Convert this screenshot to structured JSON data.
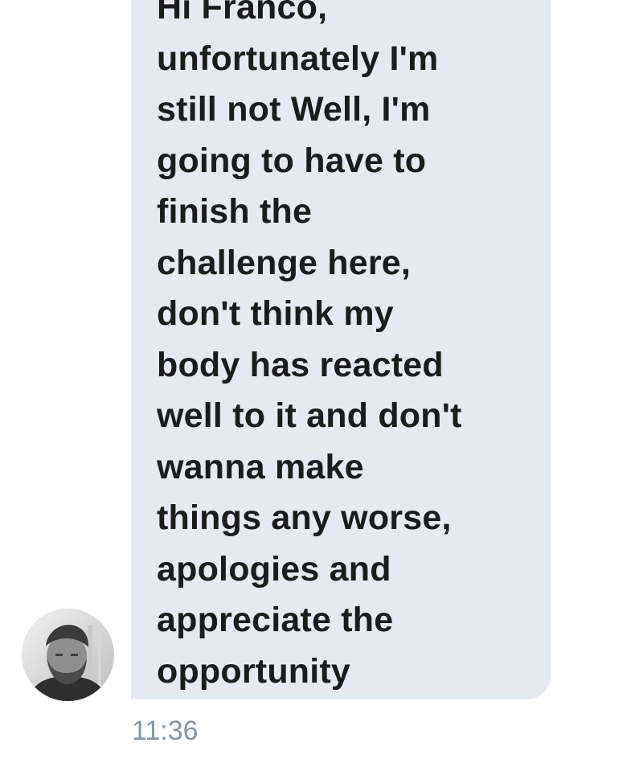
{
  "conversation": {
    "message": {
      "text": "Hi Franco,\nunfortunately I'm\nstill not Well, I'm\ngoing to have to\nfinish the\nchallenge here,\ndon't think my\nbody has reacted\nwell to it and don't\nwanna make\nthings any worse,\napologies and\nappreciate the\nopportunity",
      "time": "11:36"
    },
    "sender": {
      "avatar_icon": "user-avatar-icon"
    }
  },
  "colors": {
    "bubble": "#e6eaf0",
    "text": "#1c1c1c",
    "timestamp": "#8a94a3"
  }
}
